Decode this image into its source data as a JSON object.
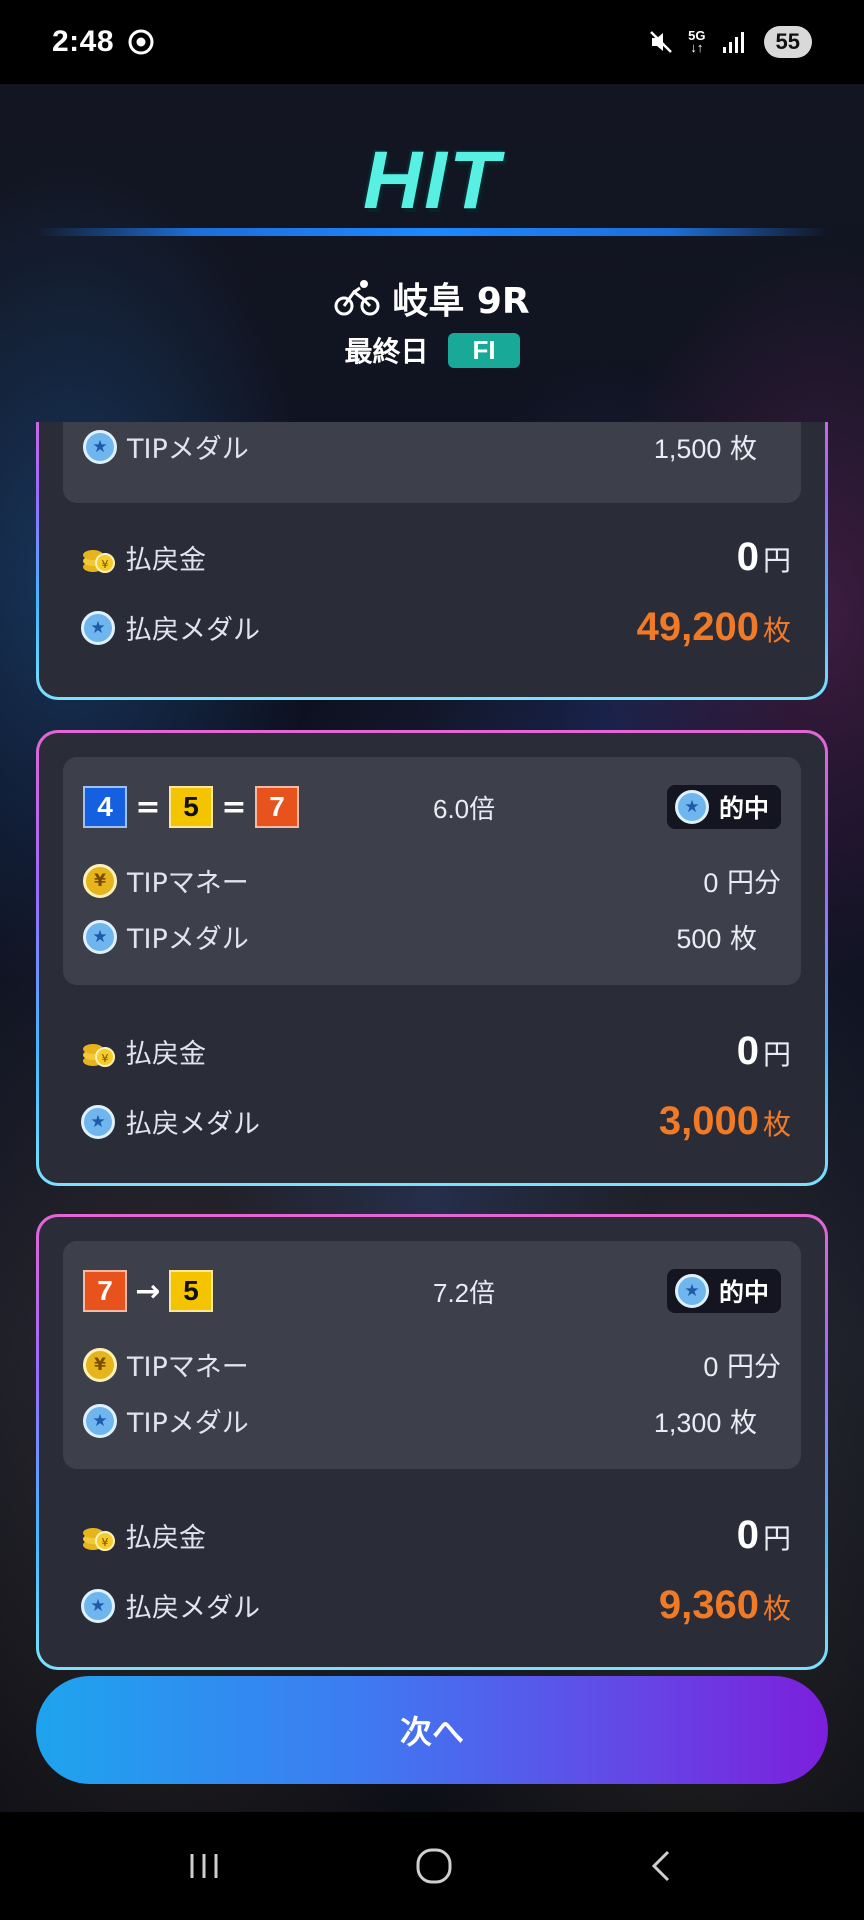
{
  "status_bar": {
    "time": "2:48",
    "network": "5G",
    "battery": "55"
  },
  "header": {
    "logo": "HIT",
    "race": "岐阜 9R",
    "day": "最終日",
    "grade": "FI"
  },
  "cards": [
    {
      "medal_label": "TIPメダル",
      "medal_value": "1,500",
      "medal_unit": "枚",
      "payout_label": "払戻金",
      "payout_value": "0",
      "payout_unit": "円",
      "payout_medal_label": "払戻メダル",
      "payout_medal_value": "49,200",
      "payout_medal_unit": "枚"
    },
    {
      "combo": [
        "4",
        "5",
        "7"
      ],
      "combo_sep": [
        "=",
        "="
      ],
      "odds": "6.0倍",
      "hit_label": "的中",
      "money_label": "TIPマネー",
      "money_value": "0",
      "money_unit": "円分",
      "medal_label": "TIPメダル",
      "medal_value": "500",
      "medal_unit": "枚",
      "payout_label": "払戻金",
      "payout_value": "0",
      "payout_unit": "円",
      "payout_medal_label": "払戻メダル",
      "payout_medal_value": "3,000",
      "payout_medal_unit": "枚"
    },
    {
      "combo": [
        "7",
        "5"
      ],
      "combo_sep": [
        "→"
      ],
      "odds": "7.2倍",
      "hit_label": "的中",
      "money_label": "TIPマネー",
      "money_value": "0",
      "money_unit": "円分",
      "medal_label": "TIPメダル",
      "medal_value": "1,300",
      "medal_unit": "枚",
      "payout_label": "払戻金",
      "payout_value": "0",
      "payout_unit": "円",
      "payout_medal_label": "払戻メダル",
      "payout_medal_value": "9,360",
      "payout_medal_unit": "枚"
    }
  ],
  "colors": {
    "box_4": "#1560e0",
    "box_5": "#f5c400",
    "box_7": "#e8521c",
    "accent_orange": "#f07a26",
    "grade_badge": "#19a999"
  },
  "next_button": "次へ",
  "icons": [
    "bicycle-icon",
    "star-medal-icon",
    "yen-coin-icon",
    "coin-stack-icon",
    "recent-apps-icon",
    "home-icon",
    "back-icon"
  ]
}
